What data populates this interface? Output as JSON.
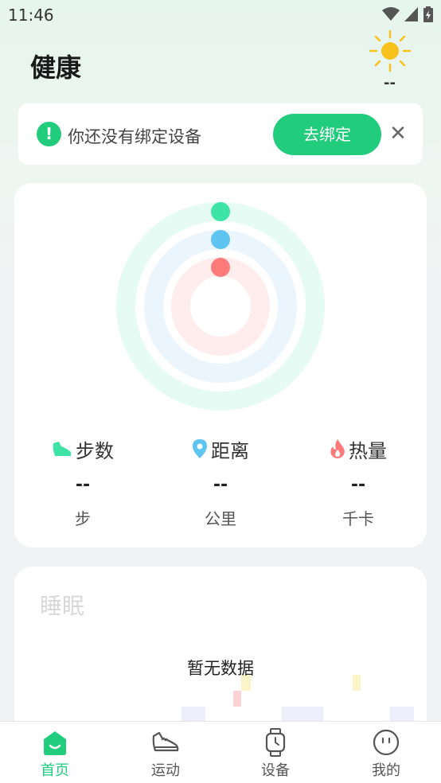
{
  "status_bar": {
    "time": "11:46"
  },
  "header": {
    "title": "健康",
    "weather_temp": "--"
  },
  "bind_banner": {
    "message": "你还没有绑定设备",
    "button_label": "去绑定",
    "alert_icon": "!",
    "close_icon": "✕"
  },
  "activity": {
    "rings": [
      {
        "name": "steps",
        "color": "#3ee3a6"
      },
      {
        "name": "distance",
        "color": "#5ec4f2"
      },
      {
        "name": "calories",
        "color": "#ff7b7b"
      }
    ],
    "stats": [
      {
        "icon": "shoe-icon",
        "label": "步数",
        "value": "--",
        "unit": "步",
        "color": "#3ee3a6"
      },
      {
        "icon": "location-pin-icon",
        "label": "距离",
        "value": "--",
        "unit": "公里",
        "color": "#5ec4f2"
      },
      {
        "icon": "flame-icon",
        "label": "热量",
        "value": "--",
        "unit": "千卡",
        "color": "#ff7b7b"
      }
    ]
  },
  "sleep": {
    "title": "睡眠",
    "empty_text": "暂无数据"
  },
  "nav": {
    "items": [
      {
        "label": "首页",
        "icon": "home-icon",
        "active": true
      },
      {
        "label": "运动",
        "icon": "sneaker-icon",
        "active": false
      },
      {
        "label": "设备",
        "icon": "watch-icon",
        "active": false
      },
      {
        "label": "我的",
        "icon": "face-icon",
        "active": false
      }
    ]
  },
  "colors": {
    "accent": "#22cc7d",
    "weather_sun": "#f7c21c"
  }
}
